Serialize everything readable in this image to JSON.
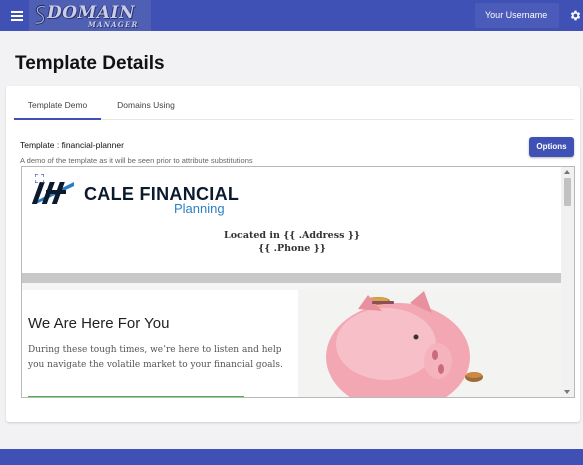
{
  "header": {
    "logo_text": "DOMAIN",
    "logo_subtext": "MANAGER",
    "username": "Your Username",
    "menu_icon": "hamburger-menu-icon",
    "settings_icon": "gear-icon"
  },
  "page": {
    "title": "Template Details"
  },
  "tabs": [
    {
      "label": "Template Demo",
      "active": true
    },
    {
      "label": "Domains Using",
      "active": false
    }
  ],
  "template": {
    "label": "Template : financial-planner",
    "description": "A demo of the template as it will be seen prior to attribute substitutions",
    "options_label": "Options"
  },
  "preview": {
    "brand_name": "CALE FINANCIAL",
    "brand_sub": "Planning",
    "address_line": "Located in {{ .Address }}",
    "phone_line": "{{ .Phone }}",
    "hero_title": "We Are Here For You",
    "hero_text": "During these tough times, we’re here to listen and help you navigate the volatile market to your financial goals."
  },
  "colors": {
    "primary": "#3f51b5",
    "brand_blue": "#2a7fc4",
    "accent_green": "#4caf50"
  }
}
